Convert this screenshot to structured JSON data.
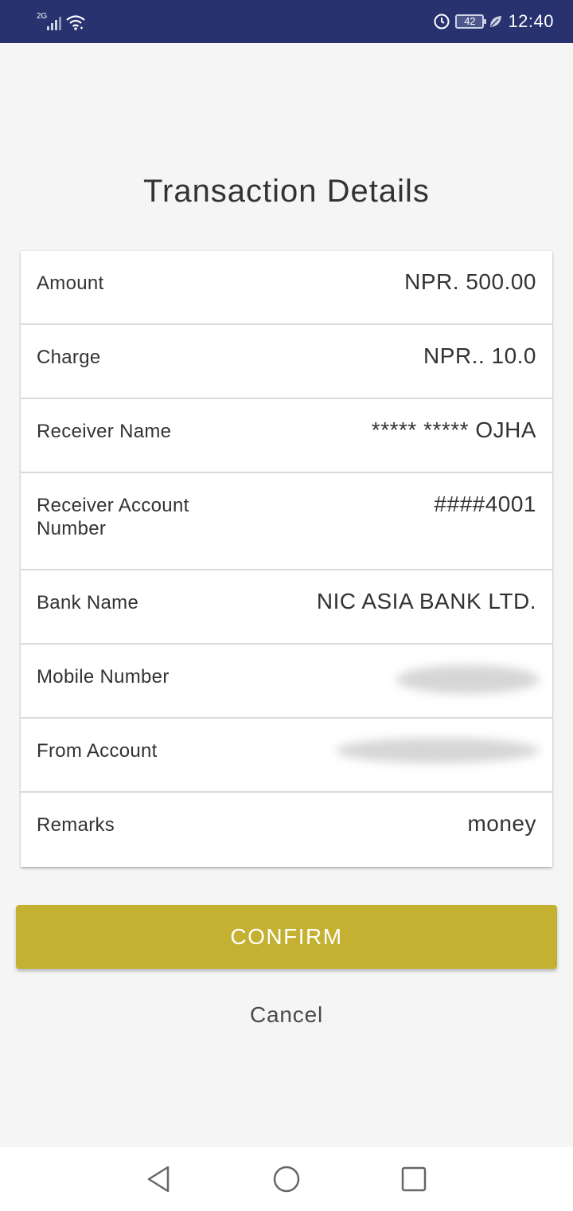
{
  "status_bar": {
    "network": "2G",
    "battery": "42",
    "time": "12:40",
    "icons": [
      "signal-icon",
      "wifi-icon",
      "alarm-icon",
      "battery-icon",
      "leaf-icon"
    ]
  },
  "title": "Transaction Details",
  "details": {
    "amount": {
      "label": "Amount",
      "value": "NPR. 500.00"
    },
    "charge": {
      "label": "Charge",
      "value": "NPR.. 10.0"
    },
    "receiver_name": {
      "label": "Receiver Name",
      "value": "***** ***** OJHA"
    },
    "receiver_account": {
      "label": "Receiver Account Number",
      "value": "####4001"
    },
    "bank_name": {
      "label": "Bank Name",
      "value": "NIC ASIA BANK LTD."
    },
    "mobile_number": {
      "label": "Mobile Number",
      "value": ""
    },
    "from_account": {
      "label": "From Account",
      "value": ""
    },
    "remarks": {
      "label": "Remarks",
      "value": "money"
    }
  },
  "actions": {
    "confirm_label": "CONFIRM",
    "cancel_label": "Cancel"
  },
  "colors": {
    "status_bar": "#27326f",
    "confirm_button": "#c4b031",
    "background": "#f5f5f5"
  },
  "nav_bar": {
    "icons": [
      "back-icon",
      "home-icon",
      "recents-icon"
    ]
  }
}
